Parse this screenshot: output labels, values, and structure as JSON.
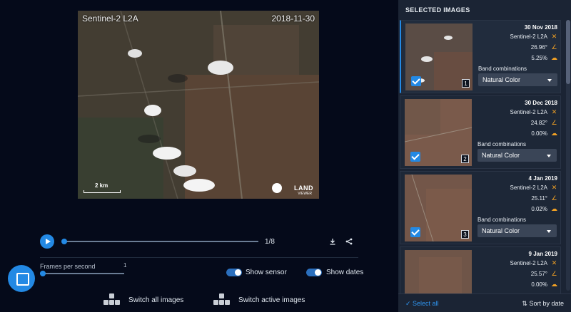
{
  "preview": {
    "sensor": "Sentinel-2 L2A",
    "date": "2018-11-30",
    "scale": "2 km",
    "logo_text": "LAND",
    "logo_sub": "VIEWER"
  },
  "player": {
    "frame_counter": "1/8",
    "progress": 0.0,
    "download_icon": "download-icon",
    "share_icon": "share-icon"
  },
  "fps": {
    "label": "Frames per second",
    "max": "1",
    "value": 0.0
  },
  "toggles": {
    "show_sensor": "Show sensor",
    "show_dates": "Show dates"
  },
  "switches": {
    "all": "Switch all images",
    "active": "Switch active images"
  },
  "sidebar": {
    "title": "SELECTED IMAGES",
    "band_label": "Band combinations",
    "select_all": "Select all",
    "sort_by": "Sort by date",
    "cards": [
      {
        "date": "30 Nov 2018",
        "sensor": "Sentinel-2 L2A",
        "angle": "26.96°",
        "cloud": "5.25%",
        "band": "Natural Color",
        "index": "1"
      },
      {
        "date": "30 Dec 2018",
        "sensor": "Sentinel-2 L2A",
        "angle": "24.82°",
        "cloud": "0.00%",
        "band": "Natural Color",
        "index": "2"
      },
      {
        "date": "4 Jan 2019",
        "sensor": "Sentinel-2 L2A",
        "angle": "25.11°",
        "cloud": "0.02%",
        "band": "Natural Color",
        "index": "3"
      },
      {
        "date": "9 Jan 2019",
        "sensor": "Sentinel-2 L2A",
        "angle": "25.57°",
        "cloud": "0.00%"
      }
    ]
  },
  "colors": {
    "accent": "#2389e4",
    "background": "#050a1a",
    "sidebar": "#1b2434",
    "icon_orange": "#f0a024"
  }
}
